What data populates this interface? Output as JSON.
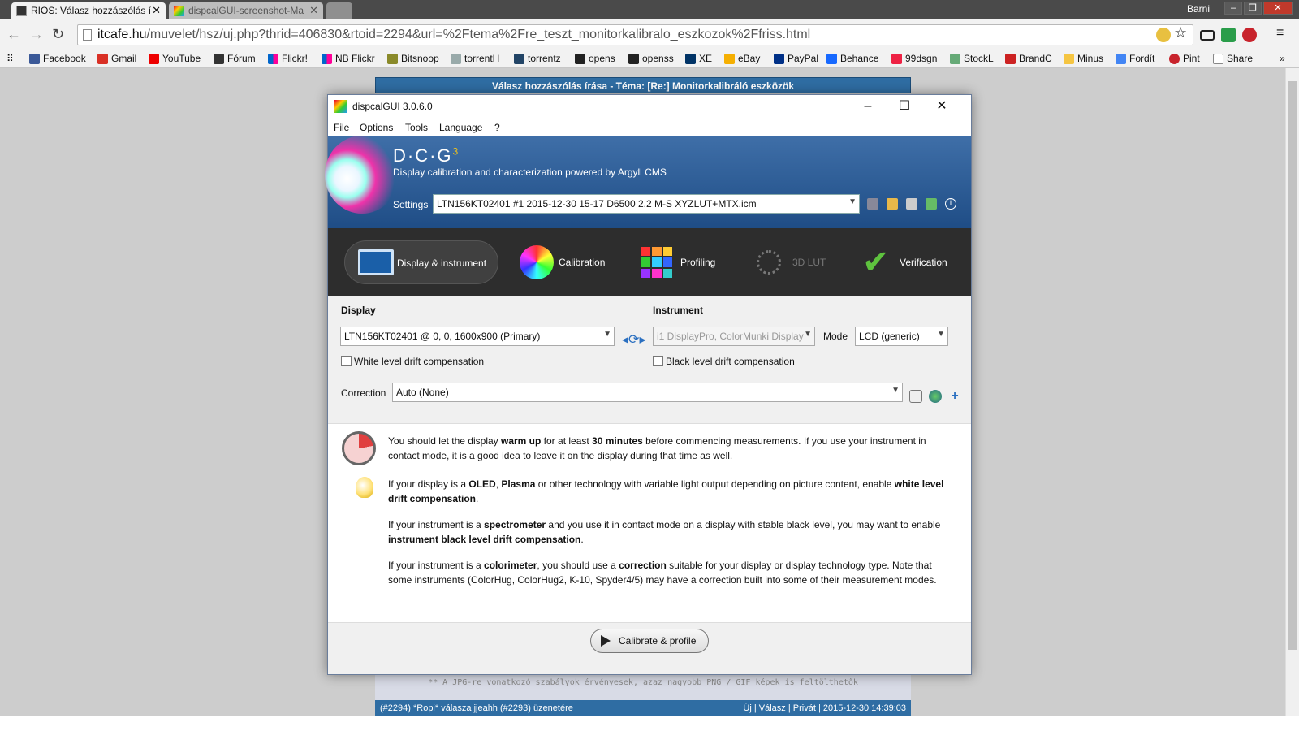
{
  "browser": {
    "tabs": [
      {
        "title": "RIOS: Válasz hozzászólás í",
        "close": "✕"
      },
      {
        "title": "dispcalGUI-screenshot-Ma",
        "close": "✕"
      }
    ],
    "user": "Barni",
    "url_host": "itcafe.hu",
    "url_path": "/muvelet/hsz/uj.php?thrid=406830&rtoid=2294&url=%2Ftema%2Fre_teszt_monitorkalibralo_eszkozok%2Ffriss.html",
    "bookmarks": [
      "Facebook",
      "Gmail",
      "YouTube",
      "Fórum",
      "Flickr!",
      "NB Flickr",
      "Bitsnoop",
      "torrentH",
      "torrentz",
      "opens",
      "openss",
      "XE",
      "eBay",
      "PayPal",
      "Behance",
      "99dsgn",
      "StockL",
      "BrandC",
      "Minus",
      "Fordít",
      "Pint",
      "Share"
    ],
    "more": "»"
  },
  "page": {
    "header": "Válasz hozzászólás írása - Téma: [Re:] Monitorkalibráló eszközök",
    "note": "** A JPG-re vonatkozó szabályok érvényesek, azaz nagyobb PNG / GIF képek is feltölthetők",
    "post_line": "(#2294) *Ropi* válasza jjeahh (#2293) üzenetére",
    "post_actions": "Új | Válasz | Privát | 2015-12-30 14:39:03"
  },
  "dialog": {
    "title": "dispcalGUI 3.0.6.0",
    "menu": [
      "File",
      "Options",
      "Tools",
      "Language",
      "?"
    ],
    "logo": "D·C·G",
    "logo_sup": "3",
    "tagline": "Display calibration and characterization powered by Argyll CMS",
    "settings_label": "Settings",
    "settings_value": "LTN156KT02401 #1 2015-12-30 15-17 D6500 2.2 M-S XYZLUT+MTX.icm",
    "tabs": [
      "Display & instrument",
      "Calibration",
      "Profiling",
      "3D LUT",
      "Verification"
    ],
    "display_label": "Display",
    "display_value": "LTN156KT02401 @ 0, 0, 1600x900 (Primary)",
    "instrument_label": "Instrument",
    "instrument_value": "i1 DisplayPro, ColorMunki Display",
    "mode_label": "Mode",
    "mode_value": "LCD (generic)",
    "white_drift": "White level drift compensation",
    "black_drift": "Black level drift compensation",
    "correction_label": "Correction",
    "correction_value": "Auto (None)",
    "info": [
      {
        "pre": "You should let the display ",
        "b1": "warm up",
        "mid": " for at least ",
        "b2": "30 minutes",
        "post": " before commencing measurements. If you use your instrument in contact mode, it is a good idea to leave it on the display during that time as well."
      },
      {
        "pre": "If your display is a ",
        "b1": "OLED",
        "mid": ", ",
        "b2": "Plasma",
        "post": " or other technology with variable light output depending on picture content, enable ",
        "b3": "white level drift compensation",
        "end": "."
      },
      {
        "pre": "If your instrument is a ",
        "b1": "spectrometer",
        "post": " and you use it in contact mode on a display with stable black level, you may want to enable ",
        "b3": "instrument black level drift compensation",
        "end": "."
      },
      {
        "pre": "If your instrument is a ",
        "b1": "colorimeter",
        "mid": ", you should use a ",
        "b2": "correction",
        "post": " suitable for your display or display technology type. Note that some instruments (ColorHug, ColorHug2, K-10, Spyder4/5) may have a correction built into some of their measurement modes."
      }
    ],
    "calibrate_button": "Calibrate & profile"
  },
  "colors": {
    "accent": "#2f6da3",
    "banner": "#2b5c96",
    "tabs_bg": "#2d2d2d",
    "check_green": "#5ec23e"
  }
}
